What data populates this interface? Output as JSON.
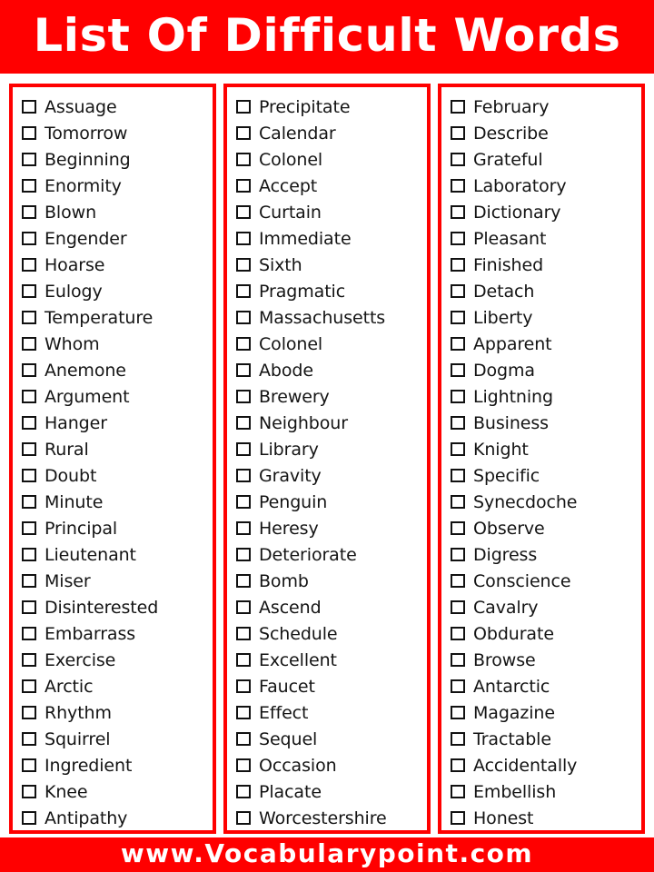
{
  "header": {
    "title": "List Of Difficult Words",
    "background_color": "#ff0000",
    "text_color": "#ffffff"
  },
  "footer": {
    "website": "www.Vocabularypoint.com",
    "background_color": "#ff0000",
    "text_color": "#ffffff"
  },
  "theme": {
    "accent_color": "#ff0000",
    "text_color": "#141414",
    "page_background": "#ffffff"
  },
  "checkbox": {
    "icon": "unchecked-checkbox-icon",
    "checked": false
  },
  "columns": [
    {
      "id": "column-1",
      "items": [
        "Assuage",
        "Tomorrow",
        "Beginning",
        "Enormity",
        "Blown",
        "Engender",
        "Hoarse",
        "Eulogy",
        "Temperature",
        "Whom",
        "Anemone",
        "Argument",
        "Hanger",
        "Rural",
        "Doubt",
        "Minute",
        "Principal",
        "Lieutenant",
        "Miser",
        "Disinterested",
        "Embarrass",
        "Exercise",
        "Arctic",
        "Rhythm",
        "Squirrel",
        "Ingredient",
        "Knee",
        "Antipathy"
      ]
    },
    {
      "id": "column-2",
      "items": [
        "Precipitate",
        "Calendar",
        "Colonel",
        "Accept",
        "Curtain",
        "Immediate",
        "Sixth",
        "Pragmatic",
        "Massachusetts",
        "Colonel",
        "Abode",
        "Brewery",
        "Neighbour",
        "Library",
        "Gravity",
        "Penguin",
        "Heresy",
        "Deteriorate",
        "Bomb",
        "Ascend",
        "Schedule",
        "Excellent",
        "Faucet",
        "Effect",
        "Sequel",
        "Occasion",
        "Placate",
        "Worcestershire"
      ]
    },
    {
      "id": "column-3",
      "items": [
        "February",
        "Describe",
        "Grateful",
        "Laboratory",
        "Dictionary",
        "Pleasant",
        "Finished",
        "Detach",
        "Liberty",
        "Apparent",
        "Dogma",
        "Lightning",
        "Business",
        "Knight",
        "Specific",
        "Synecdoche",
        "Observe",
        "Digress",
        "Conscience",
        "Cavalry",
        "Obdurate",
        "Browse",
        "Antarctic",
        "Magazine",
        "Tractable",
        "Accidentally",
        "Embellish",
        "Honest"
      ]
    }
  ]
}
